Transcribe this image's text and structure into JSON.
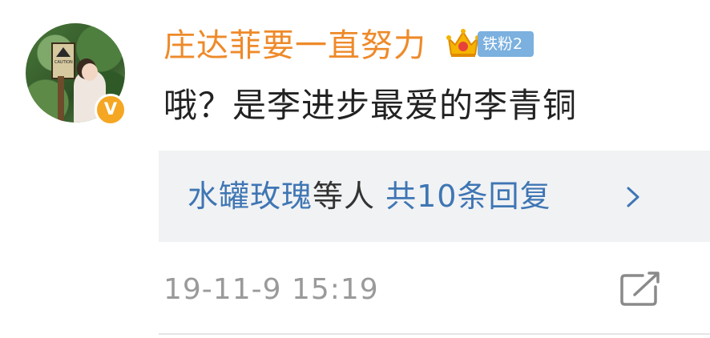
{
  "comment": {
    "username": "庄达菲要一直努力",
    "badge_label": "铁粉2",
    "text": "哦？是李进步最爱的李青铜",
    "timestamp": "19-11-9 15:19",
    "avatar": {
      "sign_text": "CAUTION",
      "verified_label": "V"
    },
    "replies": {
      "names": "水罐玫瑰",
      "connector": "等人",
      "count_text": "共10条回复"
    },
    "icons": {
      "crown": "crown-icon",
      "chevron": "chevron-right-icon",
      "edit": "edit-icon"
    },
    "colors": {
      "username": "#ee8a2a",
      "fan_badge": "#7bb0df",
      "reply_link": "#3f76b4",
      "reply_bg": "#f1f2f4",
      "verified": "#f5a623"
    }
  }
}
